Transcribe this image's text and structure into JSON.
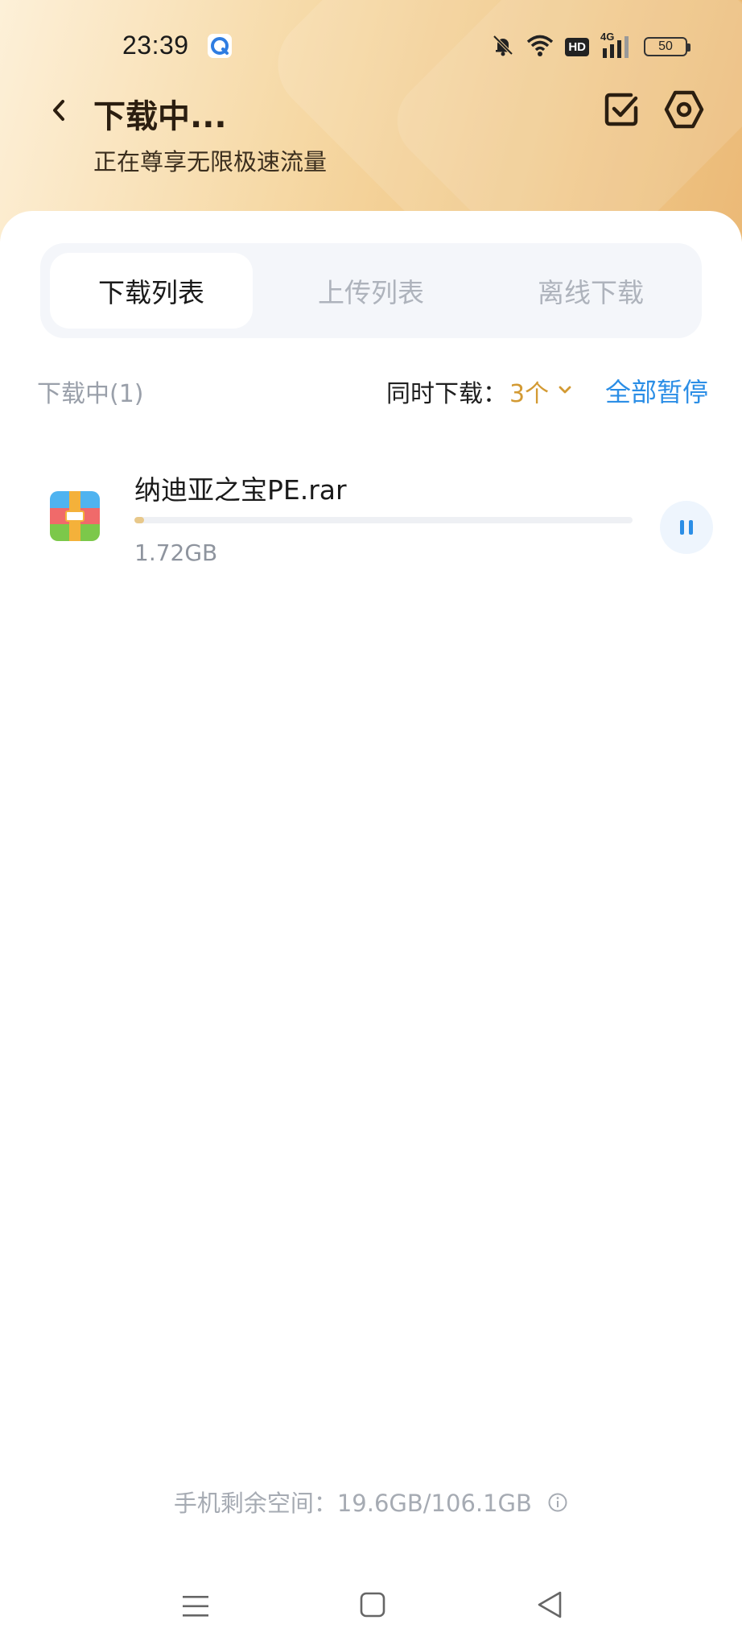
{
  "status_bar": {
    "time": "23:39",
    "app_icon": "browser-icon",
    "icons": [
      "bell-off-icon",
      "wifi-icon",
      "hd-icon",
      "signal-4g-icon",
      "battery-icon"
    ],
    "hd_text": "HD",
    "network_text": "4G",
    "battery_level": "50"
  },
  "header": {
    "back_icon": "back-arrow-icon",
    "title": "下载中...",
    "subtitle": "正在尊享无限极速流量",
    "actions": [
      {
        "name": "select-icon"
      },
      {
        "name": "settings-icon"
      }
    ]
  },
  "tabs": [
    {
      "label": "下载列表",
      "active": true
    },
    {
      "label": "上传列表",
      "active": false
    },
    {
      "label": "离线下载",
      "active": false
    }
  ],
  "section": {
    "label": "下载中(1)",
    "concurrent_label": "同时下载：",
    "concurrent_value": "3个",
    "pause_all": "全部暂停"
  },
  "downloads": [
    {
      "name": "纳迪亚之宝PE.rar",
      "size": "1.72GB",
      "progress": 0.02,
      "icon": "archive-file-icon",
      "action_icon": "pause-icon"
    }
  ],
  "footer": {
    "storage_text": "手机剩余空间：19.6GB/106.1GB",
    "info_icon": "info-icon"
  },
  "colors": {
    "accent_blue": "#2b8ee6",
    "accent_gold": "#d39a33",
    "header_gradient_start": "#fdf0d8",
    "header_gradient_end": "#e9b267"
  },
  "navbar": {
    "icons": [
      "menu-icon",
      "home-icon",
      "back-triangle-icon"
    ]
  }
}
